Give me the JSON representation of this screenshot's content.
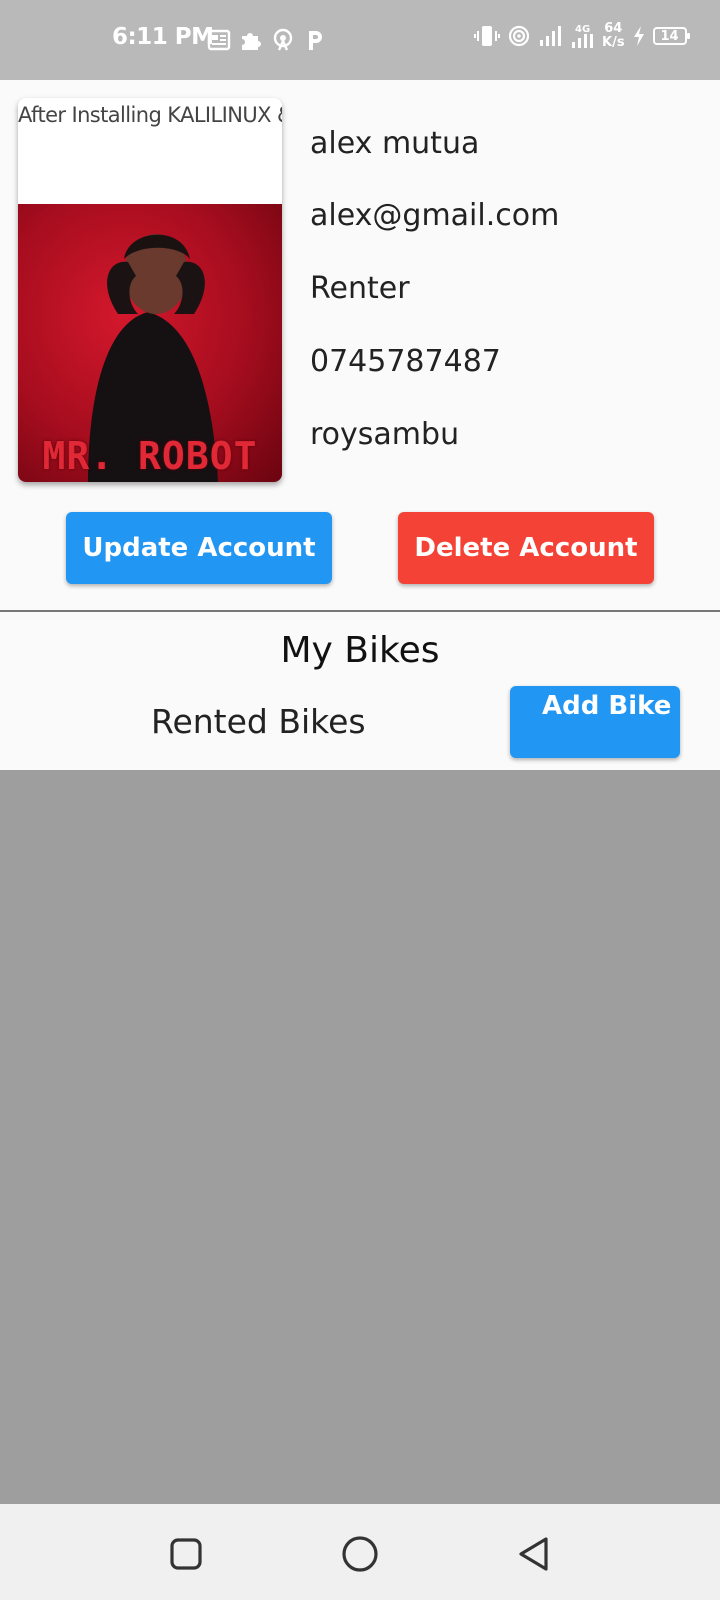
{
  "status_bar": {
    "time": "6:11 PM",
    "left_icons": [
      "news-icon",
      "puzzle-icon",
      "hotspot-icon",
      "p-app-icon"
    ],
    "speed_value": "64",
    "speed_unit": "K/s",
    "battery": "14",
    "network": "4G"
  },
  "profile": {
    "card_caption": "After Installing KALILINUX & running ' apt-get update Command :",
    "poster_title": "MR. ROBOT",
    "name": "alex mutua",
    "email": "alex@gmail.com",
    "role": "Renter",
    "phone": "0745787487",
    "location": "roysambu"
  },
  "actions": {
    "update_label": "Update Account",
    "delete_label": "Delete Account"
  },
  "bikes": {
    "section_title": "My Bikes",
    "rented_label": "Rented Bikes",
    "add_label": "Add Bike"
  },
  "colors": {
    "primary": "#2196f3",
    "danger": "#f44336",
    "status_bar": "#b9b9b9",
    "overlay": "#9e9e9e"
  },
  "nav": {
    "buttons": [
      "recents-icon",
      "home-icon",
      "back-icon"
    ]
  }
}
